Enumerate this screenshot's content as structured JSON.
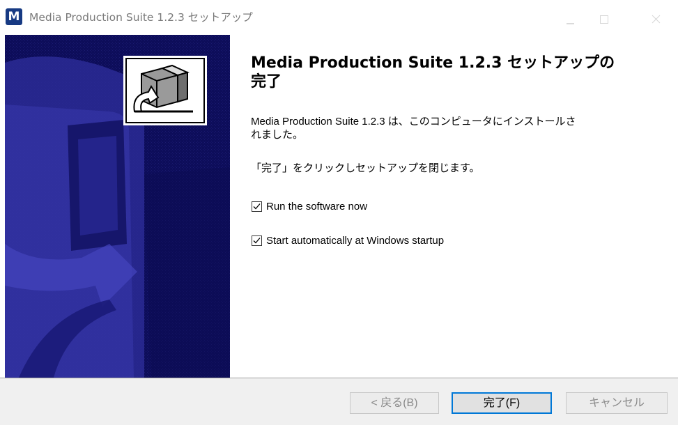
{
  "window": {
    "title": "Media Production Suite 1.2.3 セットアップ",
    "app_icon_letter": "M",
    "controls": {
      "minimize": "minimize-icon",
      "maximize": "maximize-icon",
      "close": "close-icon"
    }
  },
  "banner": {
    "icon": "installer-box-icon",
    "background_color": "#0d0d5a",
    "accent_color": "#3d3db3"
  },
  "main": {
    "heading_line1": "Media Production Suite 1.2.3 セットアップの",
    "heading_line2": "完了",
    "description_line1": "Media Production Suite 1.2.3 は、このコンピュータにインストールさ",
    "description_line2": "れました。",
    "instruction": "「完了」をクリックしセットアップを閉じます。",
    "checkboxes": [
      {
        "label": "Run the software now",
        "checked": true
      },
      {
        "label": "Start automatically at Windows startup",
        "checked": true
      }
    ]
  },
  "footer": {
    "back_button": "< 戻る(B)",
    "finish_button": "完了(F)",
    "cancel_button": "キャンセル"
  },
  "colors": {
    "focus_border": "#0078d7",
    "disabled_text": "#8a8a8a"
  }
}
